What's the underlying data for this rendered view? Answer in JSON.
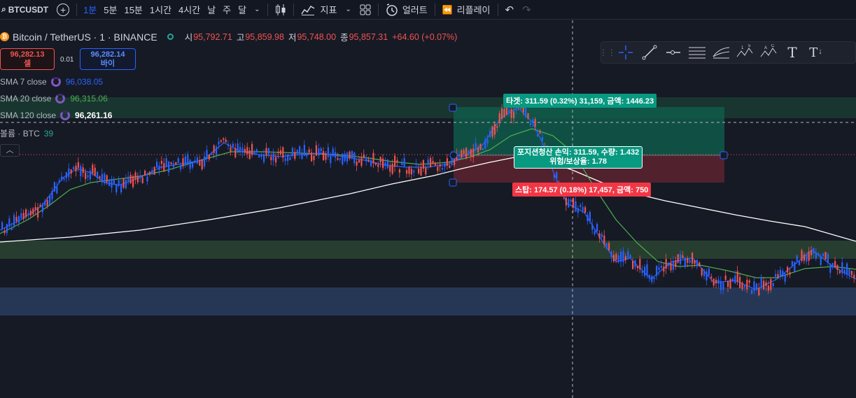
{
  "toolbar": {
    "symbol": "BTCUSDT",
    "intervals": [
      "1분",
      "5분",
      "15분",
      "1시간",
      "4시간",
      "날",
      "주",
      "달"
    ],
    "active_interval": "1분",
    "indicators_label": "지표",
    "alert_label": "얼러트",
    "replay_label": "리플레이"
  },
  "legend": {
    "title": "Bitcoin / TetherUS · 1 · BINANCE",
    "open_label": "시",
    "open": "95,792.71",
    "high_label": "고",
    "high": "95,859.98",
    "low_label": "저",
    "low": "95,748.00",
    "close_label": "종",
    "close": "95,857.31",
    "change": "+64.60 (+0.07%)"
  },
  "trade": {
    "sell_price": "96,282.13",
    "sell_label": "셀",
    "qty": "0.01",
    "buy_price": "96,282.14",
    "buy_label": "바이"
  },
  "indicators": [
    {
      "label": "SMA 7 close",
      "value": "96,038.05",
      "color": "#2962ff"
    },
    {
      "label": "SMA 20 close",
      "value": "96,315.06",
      "color": "#4caf50"
    },
    {
      "label": "SMA 120 close",
      "value": "96,261.16",
      "color": "#ffffff"
    },
    {
      "label": "볼륨 · BTC",
      "value": "39",
      "color": "#26a69a"
    }
  ],
  "collapse_icon": "chevron-up-icon",
  "position": {
    "target": "타겟: 311.59 (0.32%) 31,159, 금액: 1446.23",
    "mid_line1": "포지션청산 손익: 311.59, 수량: 1.432",
    "mid_line2": "위험/보상율: 1.78",
    "stop": "스탑: 174.57 (0.18%) 17,457, 금액: 750"
  },
  "colors": {
    "up": "#ef5350",
    "down": "#2962ff",
    "profit_zone": "#089981",
    "loss_zone": "#f23645",
    "sma7": "#2962ff",
    "sma20": "#4caf50",
    "sma120": "#ffffff"
  },
  "drawing_tools": [
    "drag-handle-icon",
    "crosshair-icon",
    "trend-line-icon",
    "horizontal-ray-icon",
    "parallel-channel-icon",
    "pitchfork-icon",
    "xabcd-pattern-icon",
    "elliott-wave-icon",
    "text-icon",
    "anchored-text-icon"
  ]
}
